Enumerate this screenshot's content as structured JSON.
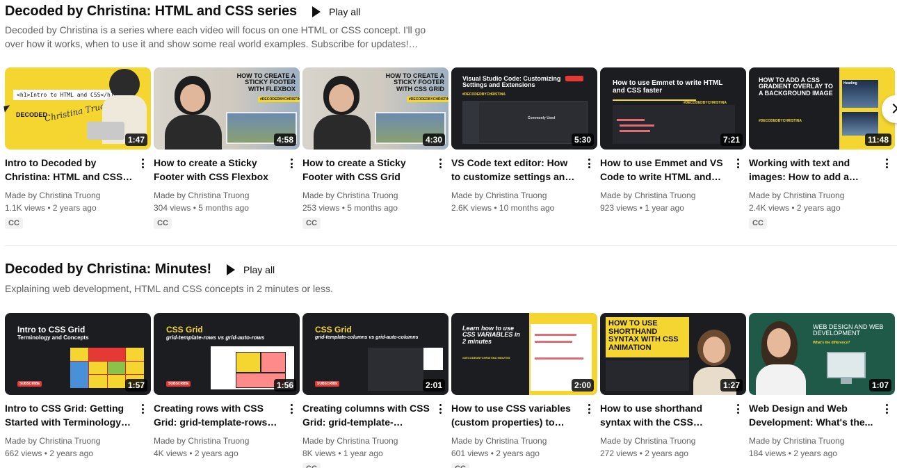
{
  "shelves": [
    {
      "title": "Decoded by Christina: HTML and CSS series",
      "play_all": "Play all",
      "description": "Decoded by Christina is a series where each video will focus on one HTML or CSS concept. I'll go over how it works, when to use it and show some real world examples. Subscribe for updates!…",
      "videos": [
        {
          "title": "Intro to Decoded by Christina: HTML and CSS series",
          "channel": "Made by Christina Truong",
          "views": "1.1K views",
          "age": "2 years ago",
          "duration": "1:47",
          "badge": "CC",
          "thumb_text": "<h1>Intro to HTML and CSS</h1>",
          "thumb_text2": "DECODED",
          "thumb_text3": "Christina Truong"
        },
        {
          "title": "How to create a Sticky Footer with CSS Flexbox",
          "channel": "Made by Christina Truong",
          "views": "304 views",
          "age": "5 months ago",
          "duration": "4:58",
          "badge": "CC",
          "thumb_text": "HOW TO CREATE A STICKY FOOTER WITH FLEXBOX",
          "thumb_text2": "#DECODEDBYCHRISTINA"
        },
        {
          "title": "How to create a Sticky Footer with CSS Grid",
          "channel": "Made by Christina Truong",
          "views": "253 views",
          "age": "5 months ago",
          "duration": "4:30",
          "badge": "CC",
          "thumb_text": "HOW TO CREATE A STICKY FOOTER WITH CSS GRID",
          "thumb_text2": "#DECODEDBYCHRISTINA"
        },
        {
          "title": "VS Code text editor: How to customize settings and add...",
          "channel": "Made by Christina Truong",
          "views": "2.6K views",
          "age": "10 months ago",
          "duration": "5:30",
          "badge": "",
          "thumb_text": "Visual Studio Code: Customizing Settings and Extensions",
          "thumb_text2": "#DECODEDBYCHRISTINA",
          "thumb_text3": "Commonly Used"
        },
        {
          "title": "How to use Emmet and VS Code to write HTML and CS...",
          "channel": "Made by Christina Truong",
          "views": "923 views",
          "age": "1 year ago",
          "duration": "7:21",
          "badge": "",
          "thumb_text": "How to use Emmet to write HTML and CSS faster",
          "thumb_text2": "#DECODEDBYCHRISTINA"
        },
        {
          "title": "Working with text and images: How to add a CSS...",
          "channel": "Made by Christina Truong",
          "views": "2.4K views",
          "age": "2 years ago",
          "duration": "11:48",
          "badge": "CC",
          "thumb_text": "HOW TO ADD A CSS GRADIENT OVERLAY TO A BACKGROUND IMAGE",
          "thumb_text2": "#DECODEDBYCHRISTINA",
          "thumb_text3": "Heading"
        }
      ]
    },
    {
      "title": "Decoded by Christina: Minutes!",
      "play_all": "Play all",
      "description": "Explaining web development, HTML and CSS concepts in 2 minutes or less.",
      "videos": [
        {
          "title": "Intro to CSS Grid: Getting Started with Terminology an...",
          "channel": "Made by Christina Truong",
          "views": "662 views",
          "age": "2 years ago",
          "duration": "1:57",
          "badge": "",
          "thumb_text": "Intro to CSS Grid",
          "thumb_text2": "Terminology and Concepts",
          "thumb_text3": "SUBSCRIBE"
        },
        {
          "title": "Creating rows with CSS Grid: grid-template-rows VS grid-...",
          "channel": "Made by Christina Truong",
          "views": "4K views",
          "age": "2 years ago",
          "duration": "1:56",
          "badge": "",
          "thumb_text": "CSS Grid",
          "thumb_text2": "grid-template-rows vs grid-auto-rows",
          "thumb_text3": "SUBSCRIBE"
        },
        {
          "title": "Creating columns with CSS Grid: grid-template-columns...",
          "channel": "Made by Christina Truong",
          "views": "8K views",
          "age": "1 year ago",
          "duration": "2:01",
          "badge": "CC",
          "thumb_text": "CSS Grid",
          "thumb_text2": "grid-template-columns vs grid-auto-columns",
          "thumb_text3": "SUBSCRIBE"
        },
        {
          "title": "How to use CSS variables (custom properties) to creat...",
          "channel": "Made by Christina Truong",
          "views": "601 views",
          "age": "2 years ago",
          "duration": "2:00",
          "badge": "CC",
          "thumb_text": "Learn how to use CSS VARIABLES in 2 minutes",
          "thumb_text2": "#DECODEDBYCHRISTINA MINUTES"
        },
        {
          "title": "How to use shorthand syntax with the CSS animation...",
          "channel": "Made by Christina Truong",
          "views": "272 views",
          "age": "2 years ago",
          "duration": "1:27",
          "badge": "",
          "thumb_text": "HOW TO USE SHORTHAND SYNTAX WITH CSS ANIMATION"
        },
        {
          "title": "Web Design and Web Development: What's the...",
          "channel": "Made by Christina Truong",
          "views": "184 views",
          "age": "2 years ago",
          "duration": "1:07",
          "badge": "",
          "thumb_text": "WEB DESIGN AND WEB DEVELOPMENT",
          "thumb_text2": "What's the difference?"
        }
      ]
    }
  ],
  "colors": {
    "accent_yellow": "#f5d631",
    "dark": "#1c1d21",
    "green": "#1f5a49",
    "text_secondary": "#606060"
  },
  "icons": {
    "play_all": "play-icon",
    "next": "chevron-right-icon",
    "more": "more-vert-icon"
  }
}
